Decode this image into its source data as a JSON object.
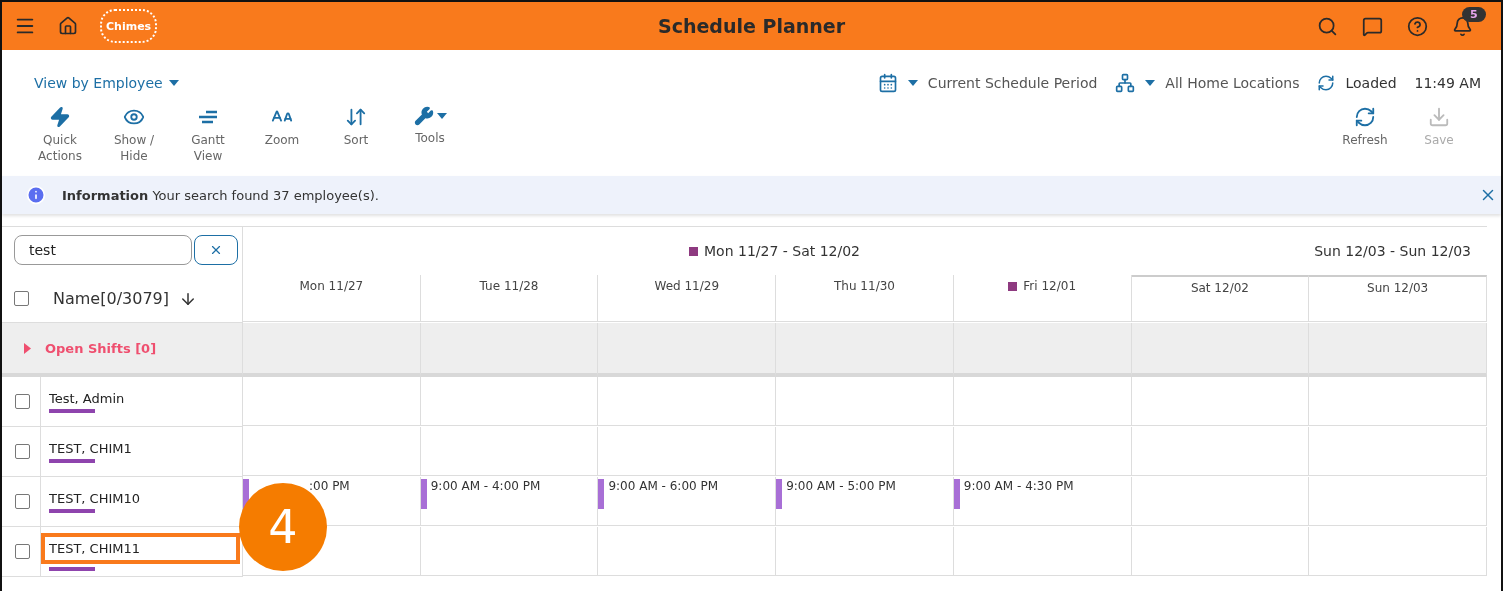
{
  "header": {
    "logo": "Chimes",
    "title": "Schedule Planner",
    "notification_count": "5"
  },
  "view_selector": {
    "label": "View by Employee"
  },
  "period": {
    "label": "Current Schedule Period"
  },
  "location": {
    "label": "All Home Locations"
  },
  "status": {
    "label": "Loaded",
    "time": "11:49 AM"
  },
  "toolbar": [
    {
      "kind": "quick",
      "label": "Quick Actions"
    },
    {
      "kind": "show",
      "label": "Show / Hide"
    },
    {
      "kind": "gantt",
      "label": "Gantt View"
    },
    {
      "kind": "zoom",
      "label": "Zoom"
    },
    {
      "kind": "sort",
      "label": "Sort"
    },
    {
      "kind": "tools",
      "label": "Tools"
    }
  ],
  "right_toolbar": [
    {
      "kind": "refresh",
      "label": "Refresh",
      "disabled": false
    },
    {
      "kind": "save",
      "label": "Save",
      "disabled": true
    }
  ],
  "info": {
    "message": "**Information** Your search found 37 employee(s)."
  },
  "search": {
    "value": "test"
  },
  "name_column": {
    "label": "Name[0/3079]",
    "checked": false
  },
  "week_ranges": [
    {
      "label": "Mon 11/27 - Sat 12/02",
      "flagged": true
    },
    {
      "label": "Sun 12/03 - Sun 12/03",
      "flagged": false
    }
  ],
  "days": [
    {
      "label": "Mon 11/27",
      "flagged": false
    },
    {
      "label": "Tue 11/28",
      "flagged": false
    },
    {
      "label": "Wed 11/29",
      "flagged": false
    },
    {
      "label": "Thu 11/30",
      "flagged": false
    },
    {
      "label": "Fri 12/01",
      "flagged": true
    },
    {
      "label": "Sat 12/02",
      "flagged": false
    },
    {
      "label": "Sun 12/03",
      "flagged": false
    }
  ],
  "open_shifts": {
    "label": "Open Shifts [0]",
    "expanded": false
  },
  "employees": [
    {
      "name": "Test, Admin",
      "checked": false,
      "highlighted": false
    },
    {
      "name": "TEST, CHIM1",
      "checked": false,
      "highlighted": false
    },
    {
      "name": "TEST, CHIM10",
      "checked": false,
      "highlighted": false,
      "shifts": [
        {
          "text": ":00 PM",
          "covered": true
        },
        {
          "text": "9:00 AM - 4:00 PM"
        },
        {
          "text": "9:00 AM - 6:00 PM"
        },
        {
          "text": "9:00 AM - 5:00 PM"
        },
        {
          "text": "9:00 AM - 4:30 PM"
        }
      ]
    },
    {
      "name": "TEST, CHIM11",
      "checked": false,
      "highlighted": true
    }
  ],
  "callout": {
    "label": "4"
  }
}
